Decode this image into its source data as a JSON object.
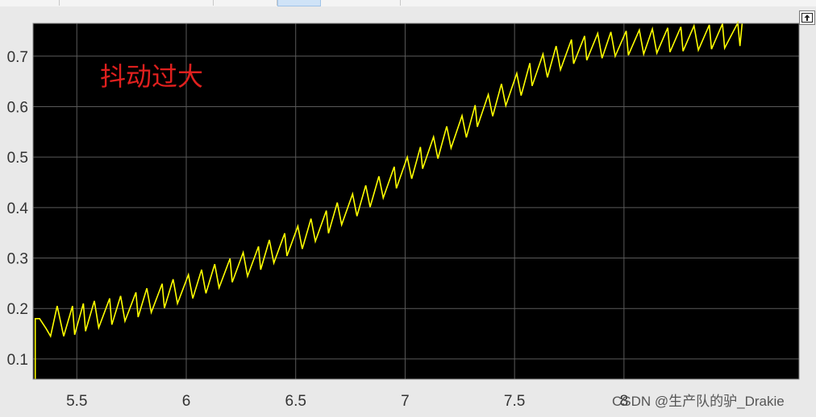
{
  "window": {
    "restore_icon": "restore-axes-icon"
  },
  "chart_data": {
    "type": "line",
    "title": "",
    "xlabel": "",
    "ylabel": "",
    "xlim": [
      5.3,
      8.8
    ],
    "ylim": [
      0.06,
      0.765
    ],
    "xticks": [
      5.5,
      6,
      6.5,
      7,
      7.5,
      8
    ],
    "xtick_labels": [
      "5.5",
      "6",
      "6.5",
      "7",
      "7.5",
      "8"
    ],
    "yticks": [
      0.1,
      0.2,
      0.3,
      0.4,
      0.5,
      0.6,
      0.7
    ],
    "ytick_labels": [
      "0.1",
      "0.2",
      "0.3",
      "0.4",
      "0.5",
      "0.6",
      "0.7"
    ],
    "grid": true,
    "background": "#000000",
    "grid_color": "#5a5a5a",
    "series": [
      {
        "color": "#ffff00",
        "x": [
          5.31,
          5.31,
          5.33,
          5.36,
          5.38,
          5.41,
          5.44,
          5.48,
          5.49,
          5.53,
          5.54,
          5.58,
          5.6,
          5.65,
          5.66,
          5.7,
          5.72,
          5.77,
          5.78,
          5.82,
          5.84,
          5.89,
          5.9,
          5.94,
          5.96,
          6.01,
          6.03,
          6.07,
          6.09,
          6.13,
          6.15,
          6.2,
          6.21,
          6.26,
          6.28,
          6.33,
          6.34,
          6.38,
          6.4,
          6.45,
          6.46,
          6.51,
          6.53,
          6.57,
          6.59,
          6.64,
          6.65,
          6.69,
          6.71,
          6.76,
          6.78,
          6.82,
          6.84,
          6.88,
          6.9,
          6.95,
          6.96,
          7.01,
          7.03,
          7.07,
          7.08,
          7.13,
          7.15,
          7.19,
          7.21,
          7.26,
          7.28,
          7.32,
          7.33,
          7.38,
          7.4,
          7.44,
          7.46,
          7.51,
          7.53,
          7.57,
          7.58,
          7.63,
          7.65,
          7.69,
          7.71,
          7.76,
          7.77,
          7.82,
          7.83,
          7.88,
          7.9,
          7.94,
          7.96,
          8.01,
          8.02,
          8.07,
          8.09,
          8.13,
          8.15,
          8.2,
          8.21,
          8.26,
          8.27,
          8.32,
          8.34,
          8.39,
          8.4,
          8.45,
          8.46,
          8.52,
          8.53,
          8.53,
          8.54
        ],
        "y": [
          0.06,
          0.18,
          0.18,
          0.16,
          0.145,
          0.205,
          0.145,
          0.205,
          0.148,
          0.21,
          0.155,
          0.215,
          0.162,
          0.22,
          0.168,
          0.225,
          0.175,
          0.232,
          0.183,
          0.24,
          0.192,
          0.249,
          0.201,
          0.258,
          0.21,
          0.267,
          0.22,
          0.277,
          0.23,
          0.288,
          0.241,
          0.299,
          0.252,
          0.311,
          0.264,
          0.323,
          0.277,
          0.336,
          0.29,
          0.349,
          0.304,
          0.363,
          0.318,
          0.378,
          0.333,
          0.394,
          0.349,
          0.41,
          0.366,
          0.427,
          0.383,
          0.444,
          0.401,
          0.462,
          0.419,
          0.481,
          0.438,
          0.5,
          0.457,
          0.52,
          0.477,
          0.54,
          0.497,
          0.561,
          0.518,
          0.582,
          0.539,
          0.603,
          0.56,
          0.624,
          0.581,
          0.645,
          0.602,
          0.666,
          0.622,
          0.686,
          0.641,
          0.704,
          0.658,
          0.72,
          0.673,
          0.733,
          0.685,
          0.74,
          0.692,
          0.745,
          0.696,
          0.748,
          0.7,
          0.75,
          0.702,
          0.752,
          0.704,
          0.754,
          0.706,
          0.756,
          0.708,
          0.758,
          0.71,
          0.76,
          0.712,
          0.762,
          0.714,
          0.764,
          0.716,
          0.766,
          0.72,
          0.72,
          0.765
        ]
      }
    ]
  },
  "annotation": {
    "text": "抖动过大",
    "color": "#e0201e"
  },
  "watermark": {
    "text": "CSDN @生产队的驴_Drakie"
  }
}
